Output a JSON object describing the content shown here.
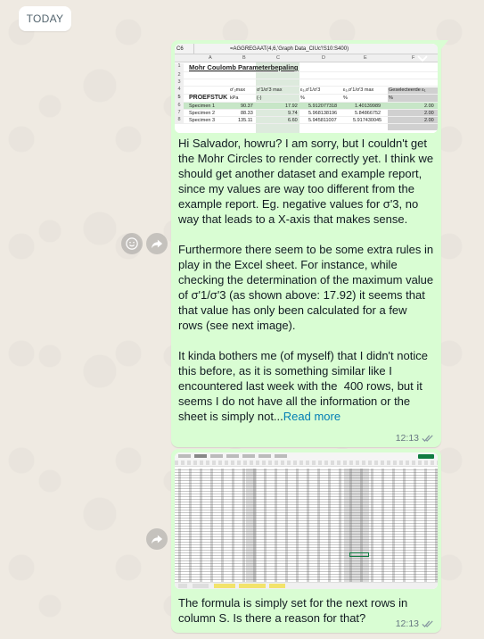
{
  "date_divider": "TODAY",
  "messages": [
    {
      "id": "msg1",
      "image": {
        "cell_ref": "C6",
        "formula": "=AGGREGAAT(4,6,'Graph Data_CIUc'!S10:S400)",
        "columns": [
          "A",
          "B",
          "C",
          "D",
          "E",
          "F"
        ],
        "row_numbers": [
          "1",
          "2",
          "3",
          "4",
          "5",
          "6",
          "7",
          "8"
        ],
        "title": "Mohr Coulomb Parameterbepaling",
        "header_row": [
          "PROEFSTUK",
          "kPa",
          "(-)",
          "%",
          "%",
          "%"
        ],
        "header_top": [
          "σ'₃max",
          "σ'1/σ'3 max",
          "ε₁,σ'1/σ'3",
          "ε₁,σ'1/σ'3 max",
          "Geselecteerde ε₁"
        ],
        "rows": [
          [
            "Specimen 1",
            "90.37",
            "17.92",
            "5.912077318",
            "1.40139989",
            "2.00"
          ],
          [
            "Specimen 2",
            "88.33",
            "9.74",
            "5.968138196",
            "5.84866752",
            "2.00"
          ],
          [
            "Specimen 3",
            "135.11",
            "6.60",
            "5.945811007",
            "5.917430045",
            "2.00"
          ]
        ]
      },
      "text": "Hi Salvador, howru? I am sorry, but I couldn't get the Mohr Circles to render correctly yet. I think we should get another dataset and example report, since my values are way too different from the example report. Eg. negative values for σ'3, no way that leads to a X-axis that makes sense.\n\nFurthermore there seem to be some extra rules in play in the Excel sheet. For instance, while checking the determination of the maximum value of σ'1/σ'3 (as shown above: 17.92) it seems that that value has only been calculated for a few rows (see next image).\n\nIt kinda bothers me (of myself) that I didn't notice this before, as it is something similar like I encountered last week with the  400 rows, but it seems I do not have all the information or the sheet is simply not...",
      "read_more": "Read more",
      "time": "12:13"
    },
    {
      "id": "msg2",
      "text": "The formula is simply set for the next rows in column S. Is there a reason for that?",
      "time": "12:13"
    }
  ],
  "icons": {
    "react": "emoji-smile-icon",
    "forward": "forward-arrow-icon",
    "dropdown": "chevron-down-icon",
    "read_receipt": "double-check-icon"
  },
  "colors": {
    "chat_bg": "#efeae2",
    "bubble_out": "#d9fdd3",
    "link": "#027eb5",
    "meta": "#667781"
  }
}
